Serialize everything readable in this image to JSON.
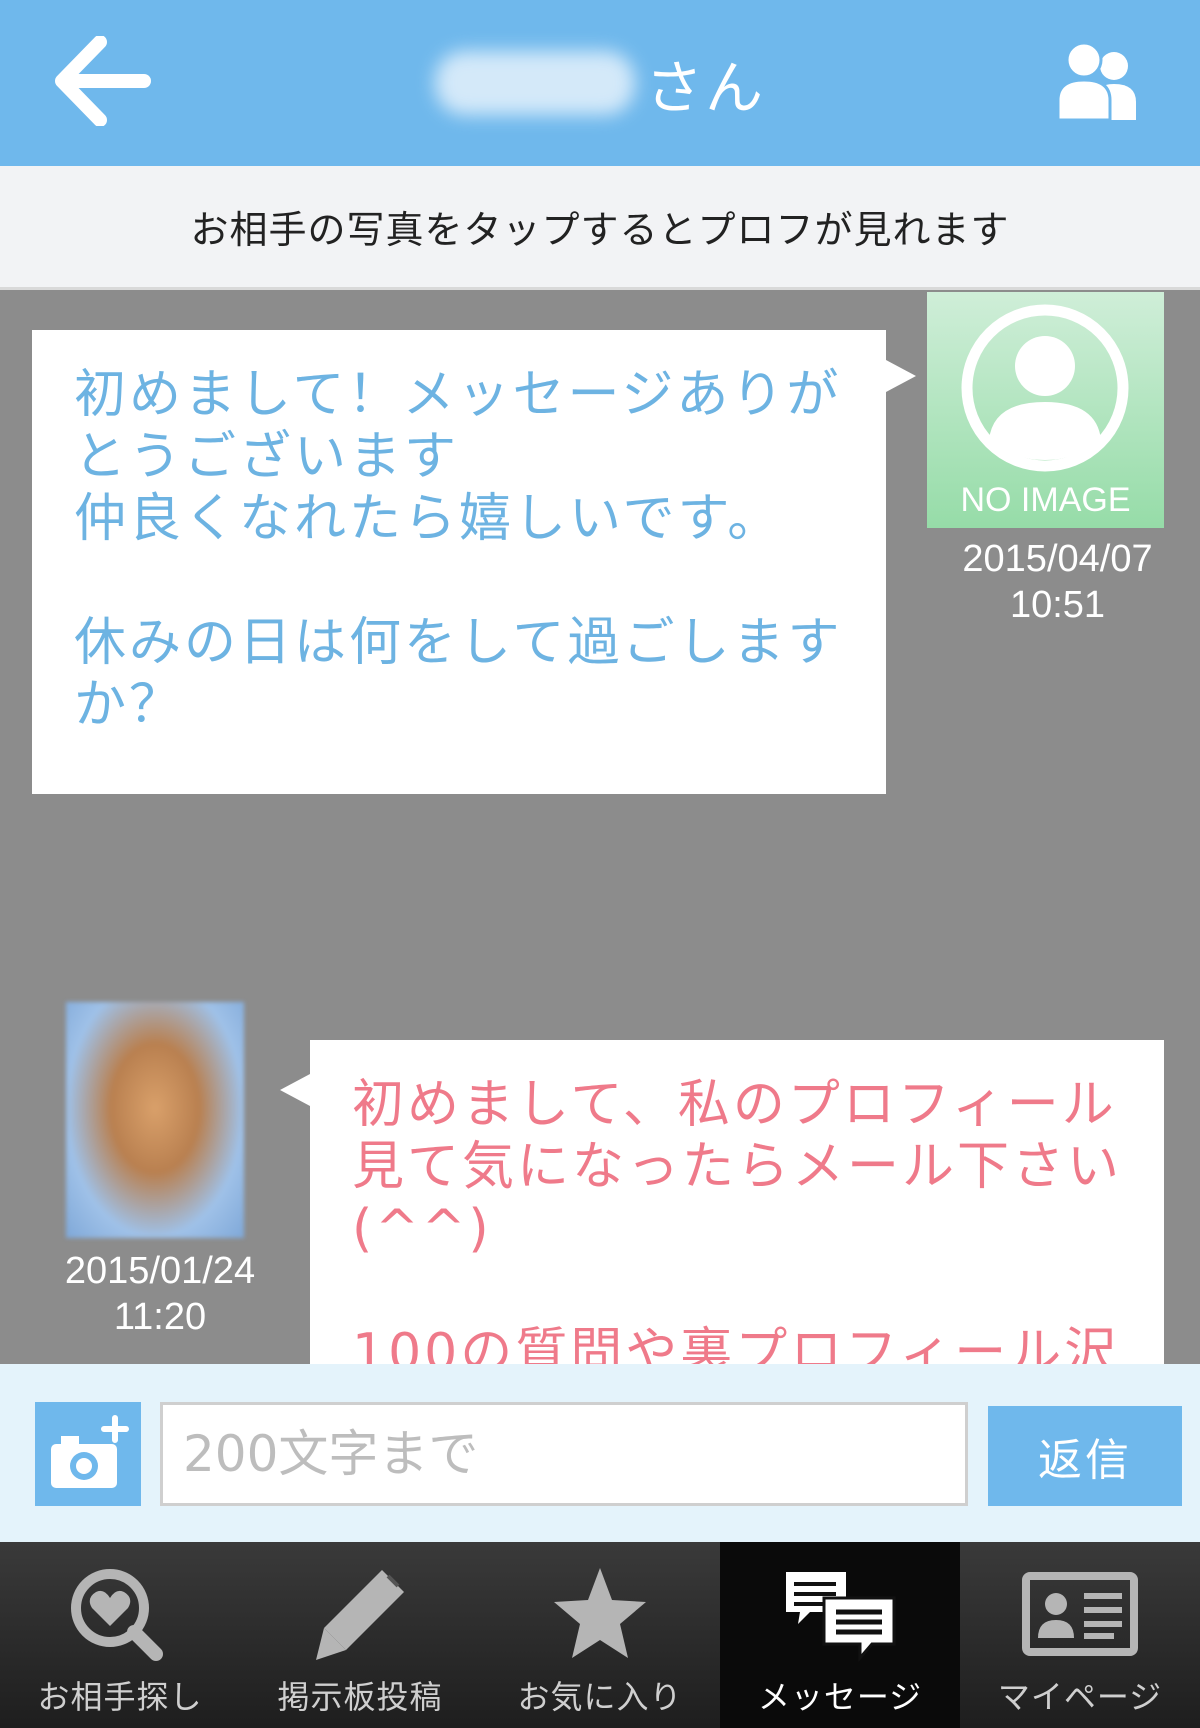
{
  "header": {
    "title_suffix": "さん",
    "back_icon": "arrow-left-icon",
    "group_icon": "people-icon"
  },
  "notice": {
    "text": "お相手の写真をタップするとプロフが見れます"
  },
  "messages": [
    {
      "side": "right",
      "text": "初めまして！メッセージありがとうございます\n仲良くなれたら嬉しいです。\n\n休みの日は何をして過ごしますか？",
      "avatar_label": "NO IMAGE",
      "date": "2015/04/07",
      "time": "10:51",
      "text_color": "#6db3e2"
    },
    {
      "side": "left",
      "text": "初めまして、私のプロフィール見て気になったらメール下さい(^^)\n\n100の質問や裏プロフィール沢",
      "date": "2015/01/24",
      "time": "11:20",
      "text_color": "#ef7a8a"
    }
  ],
  "input": {
    "placeholder": "200文字まで",
    "value": "",
    "reply_label": "返信",
    "camera_icon": "camera-plus-icon"
  },
  "tabbar": {
    "active_index": 3,
    "tabs": [
      {
        "label": "お相手探し",
        "icon": "heart-search-icon"
      },
      {
        "label": "掲示板投稿",
        "icon": "pencil-icon"
      },
      {
        "label": "お気に入り",
        "icon": "star-icon"
      },
      {
        "label": "メッセージ",
        "icon": "chat-bubbles-icon"
      },
      {
        "label": "マイページ",
        "icon": "id-card-icon"
      }
    ]
  },
  "colors": {
    "accent": "#6fb8ec",
    "background": "#8c8c8c",
    "own_message_text": "#6db3e2",
    "partner_message_text": "#ef7a8a"
  }
}
